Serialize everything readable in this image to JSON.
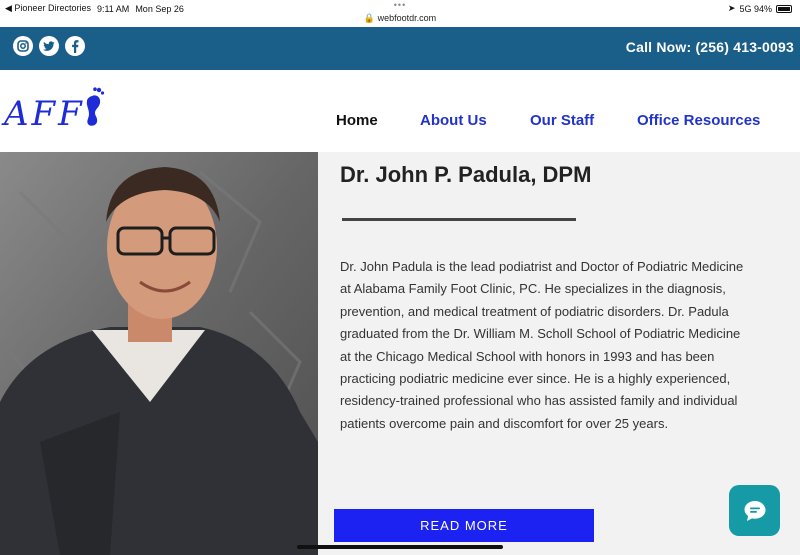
{
  "status_bar": {
    "back_app": "◀ Pioneer Directories",
    "time": "9:11 AM",
    "date": "Mon Sep 26",
    "dots": "•••",
    "url": "🔒 webfootdr.com",
    "signal": "5G 94%"
  },
  "topbar": {
    "social_icons": [
      "instagram-icon",
      "twitter-icon",
      "facebook-icon"
    ],
    "call_now": "Call Now: (256) 413-0093",
    "bg_color": "#1a5e8a"
  },
  "header": {
    "logo_text": "AFF",
    "nav": {
      "home": "Home",
      "about": "About Us",
      "staff": "Our Staff",
      "resources": "Office Resources"
    },
    "nav_accent": "#2233c8"
  },
  "profile": {
    "name": "Dr. John P. Padula, DPM",
    "bio": "Dr. John Padula is the lead podiatrist and Doctor of Podiatric Medicine at Alabama Family Foot Clinic, PC. He specializes in the diagnosis, prevention, and medical treatment of podiatric disorders. Dr. Padula graduated from the Dr. William M. Scholl School of Podiatric Medicine at the Chicago Medical School with honors in 1993 and has been practicing podiatric medicine ever since. He is a highly experienced, residency-trained professional who has assisted family and individual patients overcome pain and discomfort for over 25 years.",
    "read_more": "READ MORE",
    "button_color": "#1b22f2"
  },
  "chat": {
    "icon": "chat-bubble-icon",
    "color": "#159aa6"
  }
}
